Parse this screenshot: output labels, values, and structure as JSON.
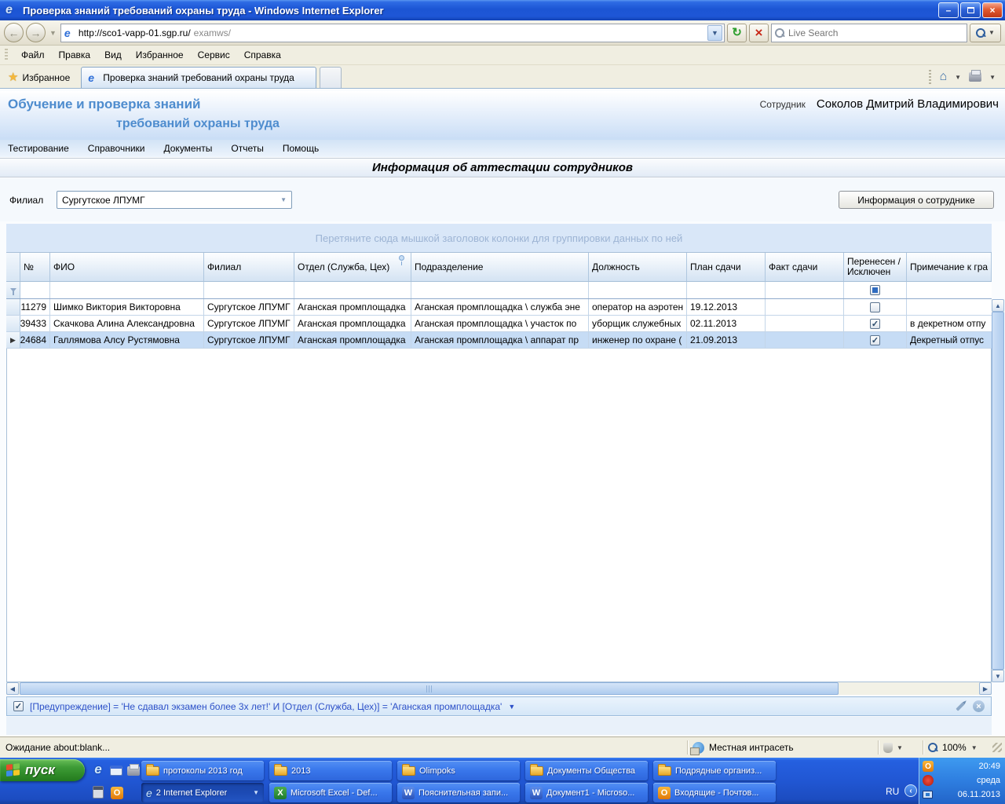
{
  "colors": {
    "titlebar_blue": "#1C55D4",
    "taskbar_blue": "#2560E0",
    "accent_blue": "#4E8CCE",
    "selection_blue": "#C6DCF5",
    "filter_text_blue": "#2D50C8"
  },
  "window": {
    "title": "Проверка знаний требований охраны труда - Windows Internet Explorer"
  },
  "browser": {
    "url_host": "http://sco1-vapp-01.sgp.ru/",
    "url_path": "examws/",
    "search_placeholder": "Live Search",
    "menu": [
      "Файл",
      "Правка",
      "Вид",
      "Избранное",
      "Сервис",
      "Справка"
    ],
    "favorites_label": "Избранное",
    "tab_title": "Проверка знаний требований охраны труда",
    "status_text": "Ожидание about:blank...",
    "status_zone": "Местная интрасеть",
    "zoom_level": "100%"
  },
  "app": {
    "title_line1": "Обучение и проверка знаний",
    "title_line2": "требований охраны труда",
    "employee_label": "Сотрудник",
    "employee_name": "Соколов Дмитрий Владимирович",
    "nav": [
      "Тестирование",
      "Справочники",
      "Документы",
      "Отчеты",
      "Помощь"
    ],
    "page_title": "Информация об аттестации сотрудников",
    "filial_label": "Филиал",
    "filial_value": "Сургутское ЛПУМГ",
    "employee_info_button": "Информация о сотруднике",
    "group_panel_hint": "Перетяните сюда мышкой заголовок колонки для группировки данных по ней",
    "filter_bar_text": "[Предупреждение] = 'Не сдавал экзамен более 3х лет!' И [Отдел (Служба, Цех)] = 'Аганская промплощадка'"
  },
  "table": {
    "columns": [
      "№",
      "ФИО",
      "Филиал",
      "Отдел (Служба, Цех)",
      "Подразделение",
      "Должность",
      "План сдачи",
      "Факт сдачи",
      "Перенесен /Исключен",
      "Примечание к гра"
    ],
    "rows": [
      {
        "num": "11279",
        "fio": "Шимко Виктория Викторовна",
        "filial": "Сургутское ЛПУМГ",
        "otdel": "Аганская промплощадка",
        "podr": "Аганская промплощадка \\ служба эне",
        "dolzh": "оператор на аэротен",
        "plan": "19.12.2013",
        "fakt": "",
        "moved": false,
        "note": ""
      },
      {
        "num": "39433",
        "fio": "Скачкова Алина Александровна",
        "filial": "Сургутское ЛПУМГ",
        "otdel": "Аганская промплощадка",
        "podr": "Аганская промплощадка \\ участок по",
        "dolzh": "уборщик служебных",
        "plan": "02.11.2013",
        "fakt": "",
        "moved": true,
        "note": "в декретном отпу"
      },
      {
        "num": "24684",
        "fio": "Галлямова Алсу Рустямовна",
        "filial": "Сургутское ЛПУМГ",
        "otdel": "Аганская промплощадка",
        "podr": "Аганская промплощадка \\ аппарат пр",
        "dolzh": "инженер по охране (",
        "plan": "21.09.2013",
        "fakt": "",
        "moved": true,
        "note": "Декретный отпус"
      }
    ]
  },
  "taskbar": {
    "start_label": "пуск",
    "row1_buttons": [
      "протоколы 2013 год",
      "2013",
      "Olimpoks",
      "Документы Общества",
      "Подрядные организ..."
    ],
    "row2_buttons": [
      "2 Internet Explorer",
      "Microsoft Excel - Def...",
      "Пояснительная запи...",
      "Документ1 - Microso...",
      "Входящие - Почтов..."
    ],
    "tray": {
      "lang": "RU",
      "time": "20:49",
      "day": "среда",
      "date": "06.11.2013"
    }
  }
}
